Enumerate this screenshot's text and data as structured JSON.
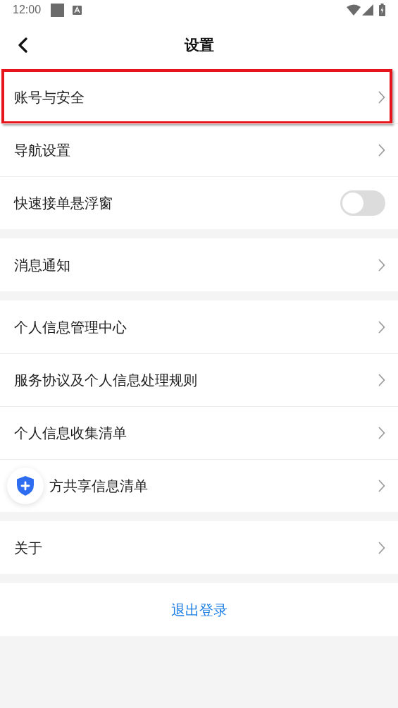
{
  "status_bar": {
    "time": "12:00"
  },
  "header": {
    "title": "设置"
  },
  "groups": [
    [
      {
        "kind": "link",
        "label": "账号与安全",
        "highlighted": true
      },
      {
        "kind": "link",
        "label": "导航设置",
        "highlighted": false
      },
      {
        "kind": "toggle",
        "label": "快速接单悬浮窗",
        "on": false,
        "highlighted": false
      }
    ],
    [
      {
        "kind": "link",
        "label": "消息通知",
        "highlighted": false
      }
    ],
    [
      {
        "kind": "link",
        "label": "个人信息管理中心",
        "highlighted": false
      },
      {
        "kind": "link",
        "label": "服务协议及个人信息处理规则",
        "highlighted": false
      },
      {
        "kind": "link",
        "label": "个人信息收集清单",
        "highlighted": false
      },
      {
        "kind": "link",
        "label": "方共享信息清单",
        "highlighted": false,
        "covered": true
      }
    ],
    [
      {
        "kind": "link",
        "label": "关于",
        "highlighted": false
      }
    ]
  ],
  "logout": {
    "label": "退出登录"
  }
}
